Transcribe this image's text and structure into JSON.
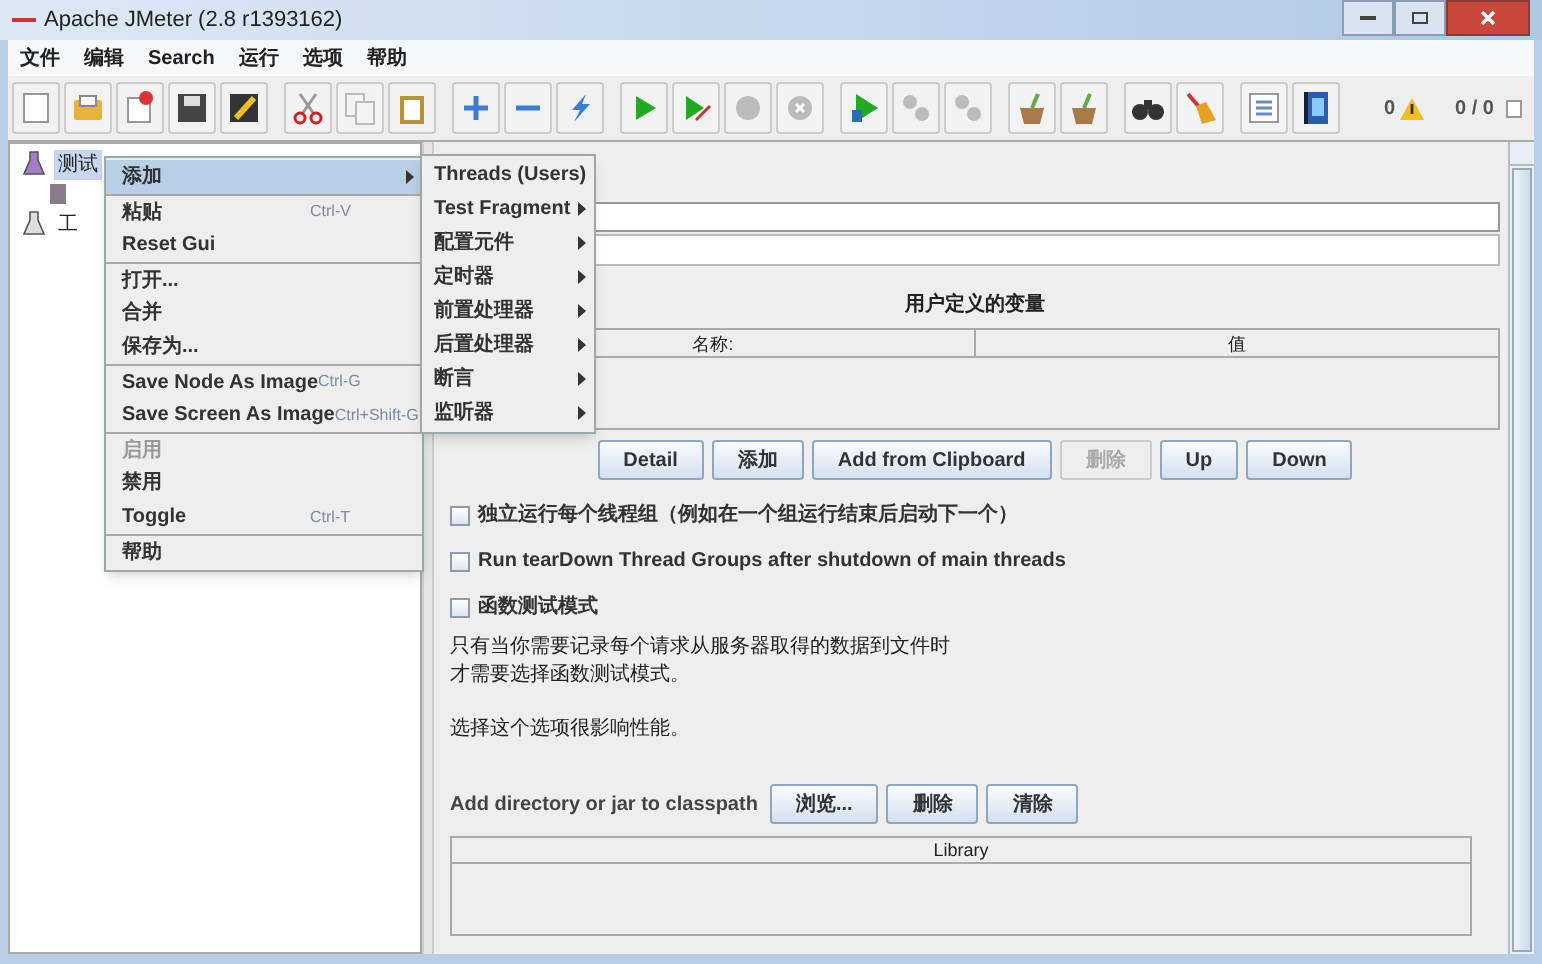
{
  "window": {
    "title": "Apache JMeter (2.8 r1393162)"
  },
  "menu_bar": [
    "文件",
    "编辑",
    "Search",
    "运行",
    "选项",
    "帮助"
  ],
  "toolbar_status": {
    "errors": "0",
    "threads": "0 / 0",
    "checked": false
  },
  "tree": [
    {
      "label": "测试",
      "selected": true,
      "children": [
        {
          "selected": false
        }
      ]
    },
    {
      "label": "工",
      "selected": false
    }
  ],
  "context_menu": [
    {
      "label": "添加",
      "selected": true,
      "disabled": false,
      "submenu": true,
      "separator_before": false
    },
    {
      "label": "粘贴",
      "shortcut": "Ctrl-V",
      "selected": false,
      "disabled": false,
      "submenu": false,
      "separator_before": true
    },
    {
      "label": "Reset Gui",
      "selected": false,
      "disabled": false,
      "submenu": false,
      "separator_before": false
    },
    {
      "label": "打开...",
      "selected": false,
      "disabled": false,
      "submenu": false,
      "separator_before": true
    },
    {
      "label": "合并",
      "selected": false,
      "disabled": false,
      "submenu": false,
      "separator_before": false
    },
    {
      "label": "保存为...",
      "selected": false,
      "disabled": false,
      "submenu": false,
      "separator_before": false
    },
    {
      "label": "Save Node As Image",
      "shortcut": "Ctrl-G",
      "selected": false,
      "disabled": false,
      "submenu": false,
      "separator_before": true
    },
    {
      "label": "Save Screen As Image",
      "shortcut": "Ctrl+Shift-G",
      "selected": false,
      "disabled": false,
      "submenu": false,
      "separator_before": false
    },
    {
      "label": "启用",
      "selected": false,
      "disabled": true,
      "submenu": false,
      "separator_before": true
    },
    {
      "label": "禁用",
      "selected": false,
      "disabled": false,
      "submenu": false,
      "separator_before": false
    },
    {
      "label": "Toggle",
      "shortcut": "Ctrl-T",
      "selected": false,
      "disabled": false,
      "submenu": false,
      "separator_before": false
    },
    {
      "label": "帮助",
      "selected": false,
      "disabled": false,
      "submenu": false,
      "separator_before": true
    }
  ],
  "submenu": [
    "Threads (Users)",
    "Test Fragment",
    "配置元件",
    "定时器",
    "前置处理器",
    "后置处理器",
    "断言",
    "监听器"
  ],
  "variables": {
    "title": "用户定义的变量",
    "columns": [
      "名称:",
      "值"
    ]
  },
  "variable_buttons": [
    {
      "label": "Detail",
      "disabled": false
    },
    {
      "label": "添加",
      "disabled": false
    },
    {
      "label": "Add from Clipboard",
      "disabled": false
    },
    {
      "label": "删除",
      "disabled": true
    },
    {
      "label": "Up",
      "disabled": false
    },
    {
      "label": "Down",
      "disabled": false
    }
  ],
  "options": [
    {
      "label": "独立运行每个线程组（例如在一个组运行结束后启动下一个）",
      "checked": false
    },
    {
      "label": "Run tearDown Thread Groups after shutdown of main threads",
      "checked": false
    },
    {
      "label": "函数测试模式",
      "checked": false
    }
  ],
  "notes": [
    "只有当你需要记录每个请求从服务器取得的数据到文件时",
    "才需要选择函数测试模式。",
    "选择这个选项很影响性能。"
  ],
  "classpath": {
    "label": "Add directory or jar to classpath",
    "buttons": [
      "浏览...",
      "删除",
      "清除"
    ],
    "column": "Library"
  }
}
